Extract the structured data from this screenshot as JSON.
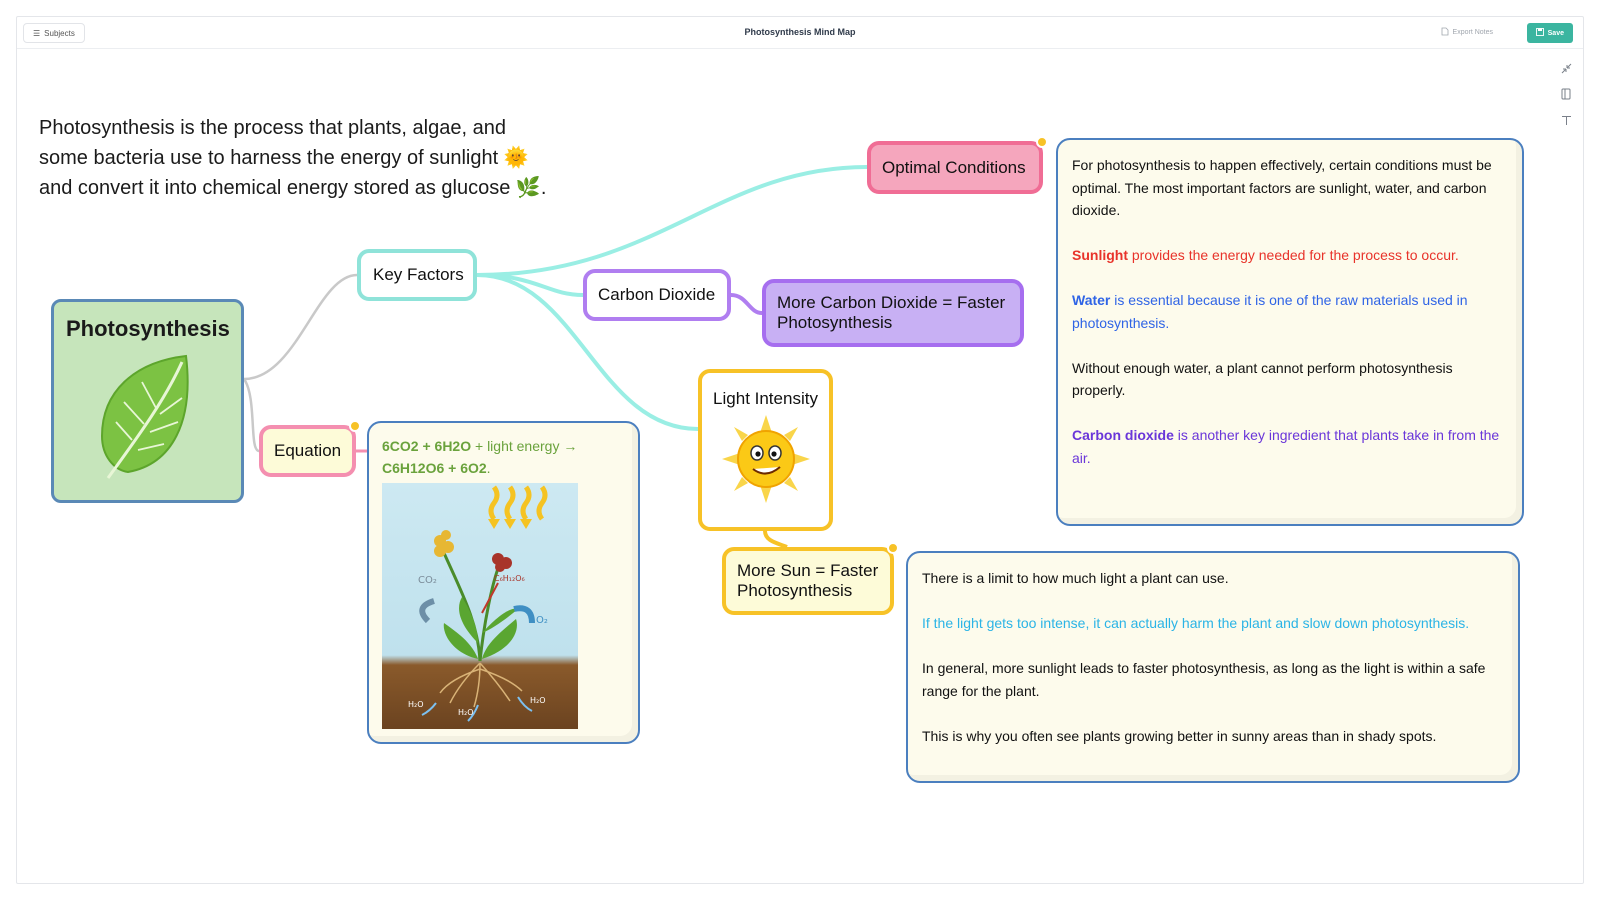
{
  "header": {
    "subjects_label": "Subjects",
    "title": "Photosynthesis Mind Map",
    "export_label": "Export Notes",
    "save_label": "Save"
  },
  "intro": {
    "text": "Photosynthesis is the process that plants, algae, and some bacteria use to harness the energy of sunlight 🌞 and convert it into chemical energy stored as glucose 🌿."
  },
  "nodes": {
    "central": "Photosynthesis",
    "key_factors": "Key Factors",
    "equation": "Equation",
    "optimal_conditions": "Optimal Conditions",
    "carbon_dioxide": "Carbon Dioxide",
    "more_co2": "More Carbon Dioxide = Faster Photosynthesis",
    "light_intensity": "Light Intensity",
    "more_sun": "More Sun = Faster Photosynthesis"
  },
  "equation_card": {
    "formula_line1_a": "6CO2 + 6H2O",
    "formula_line1_b": " + light energy →",
    "formula_line2": "C6H12O6 + 6O2",
    "formula_line2_end": ".",
    "diagram_labels": {
      "co2": "CO₂",
      "glucose": "C₆H₁₂O₆",
      "o2": "O₂",
      "h2o": "H₂O"
    }
  },
  "notes_optimal": {
    "p1": "For photosynthesis to happen effectively, certain conditions must be optimal. The most important factors are sunlight, water, and carbon dioxide.",
    "p2_bold": "Sunlight",
    "p2_rest": " provides the energy needed for the process to occur.",
    "p3_bold": "Water",
    "p3_rest": " is essential because it is one of the raw materials used in photosynthesis.",
    "p4": "Without enough water, a plant cannot perform photosynthesis properly.",
    "p5_bold": "Carbon dioxide",
    "p5_rest": " is another key ingredient that plants take in from the air."
  },
  "notes_light": {
    "p1": "There is a limit to how much light a plant can use.",
    "p2": "If the light gets too intense, it can actually harm the plant and slow down photosynthesis.",
    "p3": "In general, more sunlight leads to faster photosynthesis, as long as the light is within a safe range for the plant.",
    "p4": "This is why you often see plants growing better in sunny areas than in shady spots."
  },
  "icons": [
    "list-icon",
    "export-icon",
    "save-icon",
    "collapse-icon",
    "panel-icon",
    "text-icon",
    "leaf-icon",
    "sun-icon"
  ],
  "colors": {
    "accent": "#3bb5a0",
    "key_factors_border": "#8fe3d9",
    "equation_border": "#f48fb0",
    "optimal_fill": "#f5a6bd",
    "carbon_border": "#b07ef0",
    "light_border": "#f7c227",
    "central_fill": "#c6e5bb"
  }
}
